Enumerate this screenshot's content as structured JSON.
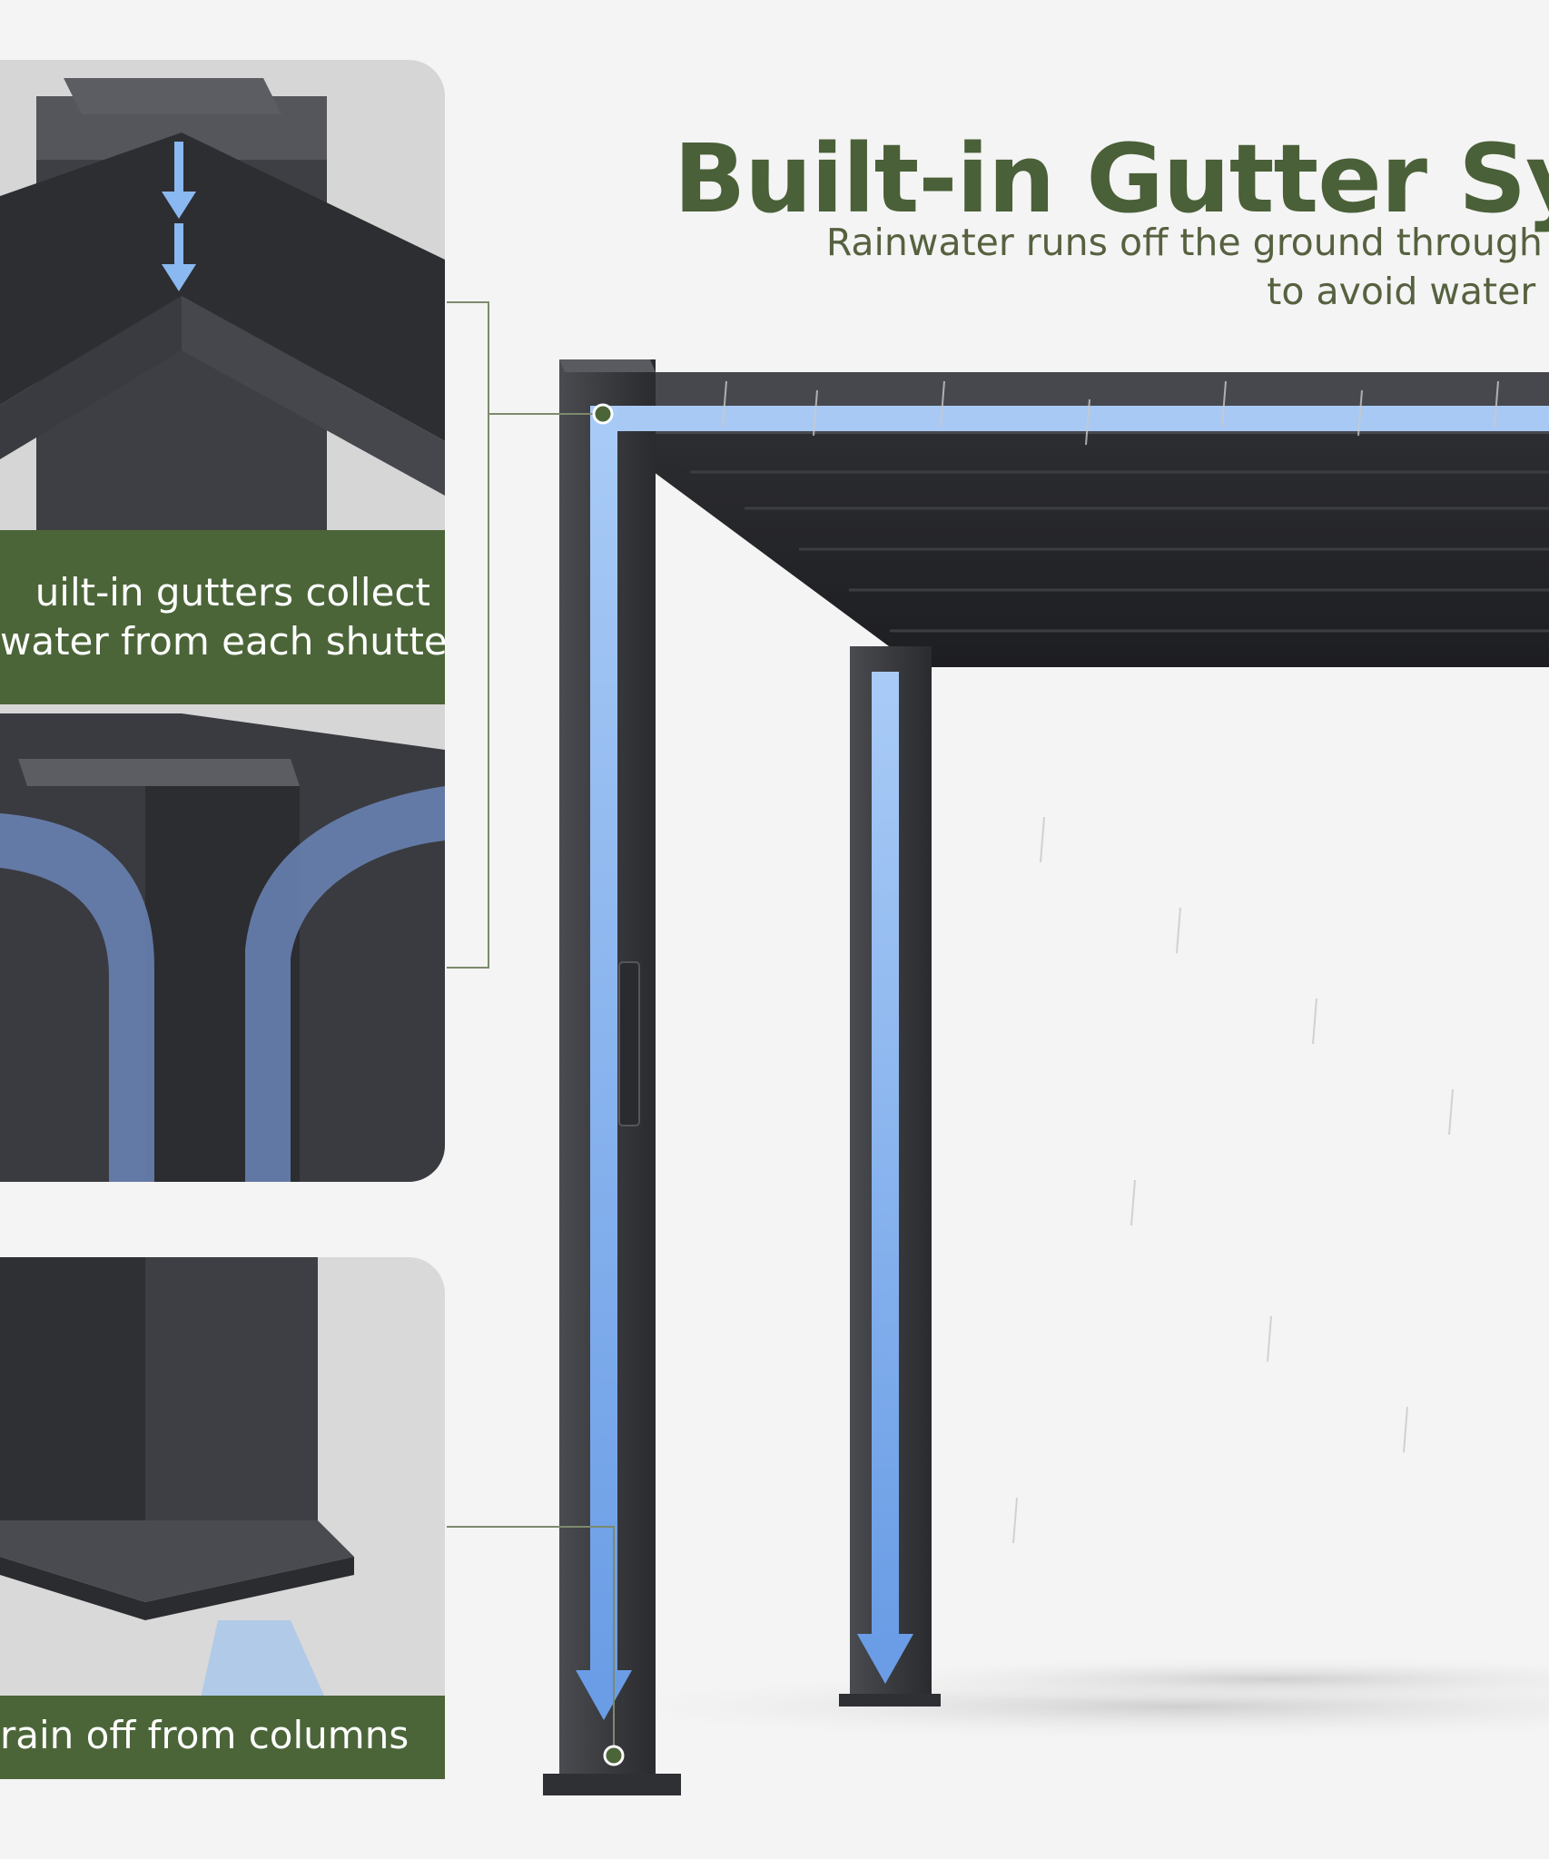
{
  "title": "Built-in Gutter Syste",
  "subtitle": {
    "line1": "Rainwater runs off the ground through hidden drain gu",
    "line2": "to avoid water pooling on rainy"
  },
  "captions": {
    "gutters_line1": "uilt-in gutters collect",
    "gutters_line2": "water from each shutter",
    "columns": "rain off from columns"
  },
  "colors": {
    "accent_green": "#4b6538",
    "title_green": "#4a6038",
    "water_blue": "#7fb0ee",
    "frame_dark": "#3d3e42"
  }
}
